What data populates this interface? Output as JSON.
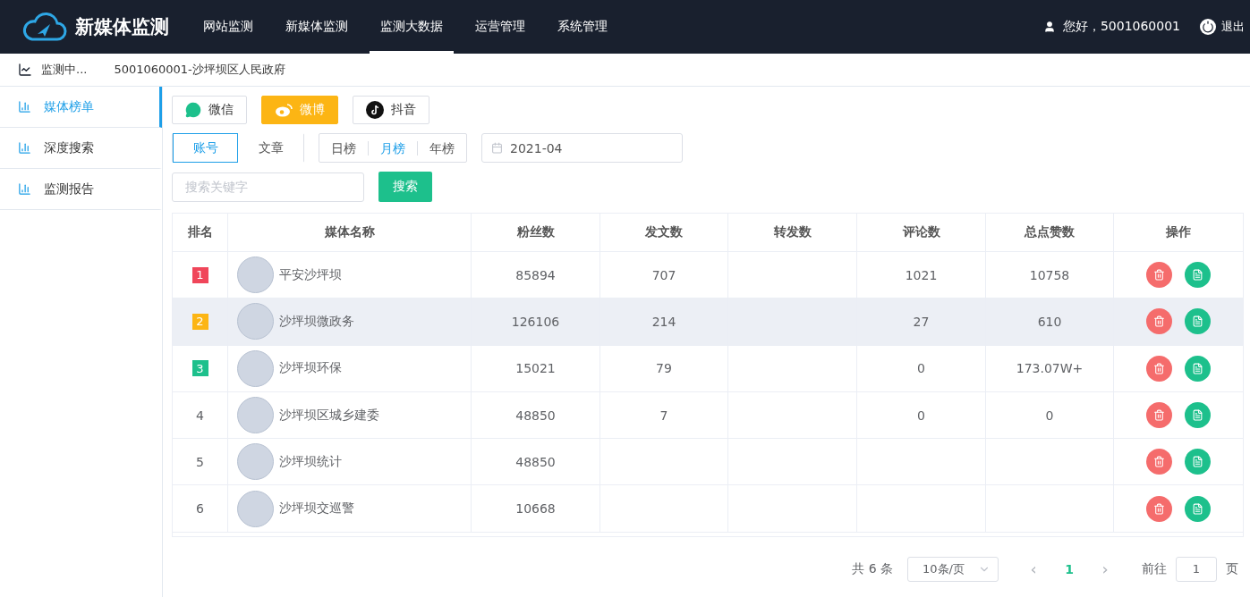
{
  "header": {
    "logo_text": "新媒体监测",
    "nav": [
      {
        "label": "网站监测",
        "selected": false
      },
      {
        "label": "新媒体监测",
        "selected": false
      },
      {
        "label": "监测大数据",
        "selected": true
      },
      {
        "label": "运营管理",
        "selected": false
      },
      {
        "label": "系统管理",
        "selected": false
      }
    ],
    "greeting": "您好，5001060001",
    "logout": "退出"
  },
  "breadcrumb": {
    "title": "监测中...",
    "org": "5001060001-沙坪坝区人民政府"
  },
  "sidebar": {
    "items": [
      {
        "label": "媒体榜单",
        "selected": true
      },
      {
        "label": "深度搜索",
        "selected": false
      },
      {
        "label": "监测报告",
        "selected": false
      }
    ]
  },
  "platforms": [
    {
      "kind": "wechat",
      "label": "微信",
      "selected": false
    },
    {
      "kind": "weibo",
      "label": "微博",
      "selected": true
    },
    {
      "kind": "douyin",
      "label": "抖音",
      "selected": false
    }
  ],
  "mode_tabs": [
    {
      "label": "账号",
      "selected": true
    },
    {
      "label": "文章",
      "selected": false
    }
  ],
  "period_tabs": [
    {
      "label": "日榜",
      "selected": false
    },
    {
      "label": "月榜",
      "selected": true
    },
    {
      "label": "年榜",
      "selected": false
    }
  ],
  "date_field": {
    "value": "2021-04"
  },
  "search": {
    "placeholder": "搜索关键字",
    "button": "搜索"
  },
  "table": {
    "columns": [
      "排名",
      "媒体名称",
      "粉丝数",
      "发文数",
      "转发数",
      "评论数",
      "总点赞数",
      "操作"
    ],
    "rows": [
      {
        "rank": "1",
        "color": "#f0465a",
        "name": "平安沙坪坝",
        "fans": "85894",
        "posts": "707",
        "comments": "1021",
        "likes": "10758",
        "selected": false
      },
      {
        "rank": "2",
        "color": "#fcb514",
        "name": "沙坪坝微政务",
        "fans": "126106",
        "posts": "214",
        "comments": "27",
        "likes": "610",
        "selected": true
      },
      {
        "rank": "3",
        "color": "#1dc08c",
        "name": "沙坪坝环保",
        "fans": "15021",
        "posts": "79",
        "comments": "0",
        "likes": "173.07W+",
        "selected": false
      },
      {
        "rank": "4",
        "name": "沙坪坝区城乡建委",
        "fans": "48850",
        "posts": "7",
        "comments": "0",
        "likes": "0",
        "selected": false
      },
      {
        "rank": "5",
        "name": "沙坪坝统计",
        "fans": "48850",
        "selected": false
      },
      {
        "rank": "6",
        "name": "沙坪坝交巡警",
        "fans": "10668",
        "selected": false
      }
    ]
  },
  "pagination": {
    "total": "共 6 条",
    "page_size": "10条/页",
    "prev": "‹",
    "pages": [
      {
        "label": "1",
        "selected": true
      }
    ],
    "next": "›",
    "goto_label": "前往",
    "goto_value": "1",
    "page_suffix": "页"
  }
}
